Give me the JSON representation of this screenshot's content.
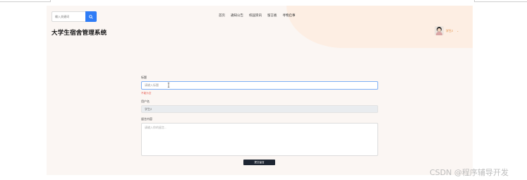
{
  "header": {
    "search_placeholder": "输入关键词",
    "nav": [
      "首页",
      "通知公告",
      "校园资讯",
      "留言板",
      "寻物启事"
    ],
    "site_title": "大学生宿舍管理系统",
    "user_name": "学生2",
    "user_dropdown": "⌄"
  },
  "form": {
    "title_label": "标题",
    "title_placeholder": "请输入标题",
    "title_error": "不能为空",
    "username_label": "用户名",
    "username_value": "学生2",
    "message_label": "留言内容",
    "message_placeholder": "请输入你的留言...",
    "submit_label": "提交留言"
  },
  "watermark": "CSDN @程序辅导开发",
  "colors": {
    "accent": "#2f7cf6",
    "error": "#e85a4f",
    "submit_bg": "#1e2633",
    "user_text": "#e08a3c"
  }
}
